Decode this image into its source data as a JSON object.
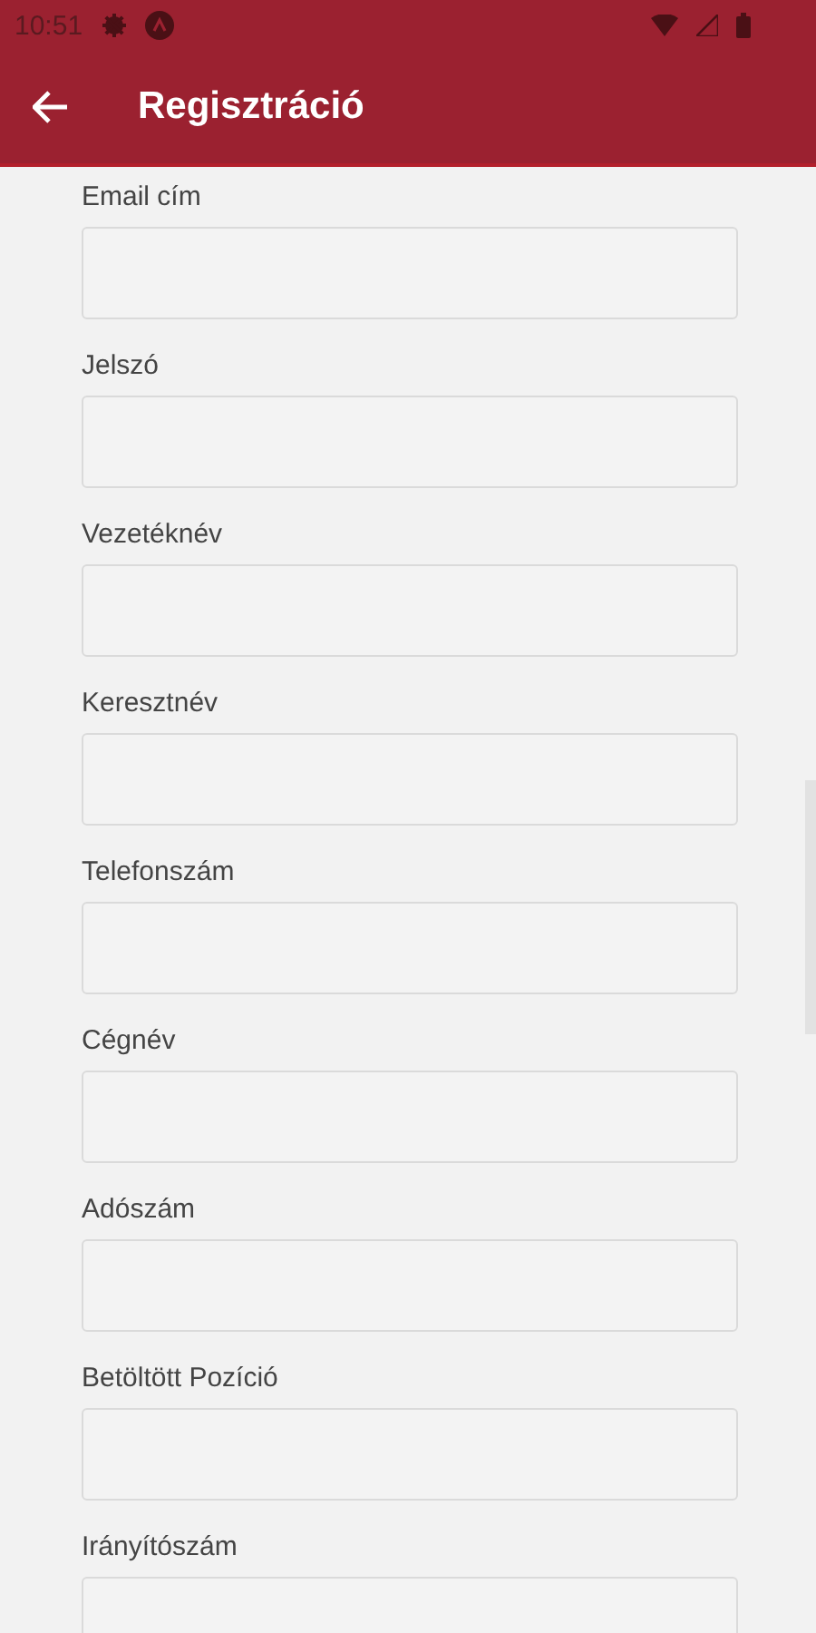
{
  "status_bar": {
    "time": "10:51"
  },
  "app_bar": {
    "title": "Regisztráció"
  },
  "fields": [
    {
      "label": "Email cím"
    },
    {
      "label": "Jelszó"
    },
    {
      "label": "Vezetéknév"
    },
    {
      "label": "Keresztnév"
    },
    {
      "label": "Telefonszám"
    },
    {
      "label": "Cégnév"
    },
    {
      "label": "Adószám"
    },
    {
      "label": "Betöltött Pozíció"
    },
    {
      "label": "Irányítószám"
    }
  ]
}
